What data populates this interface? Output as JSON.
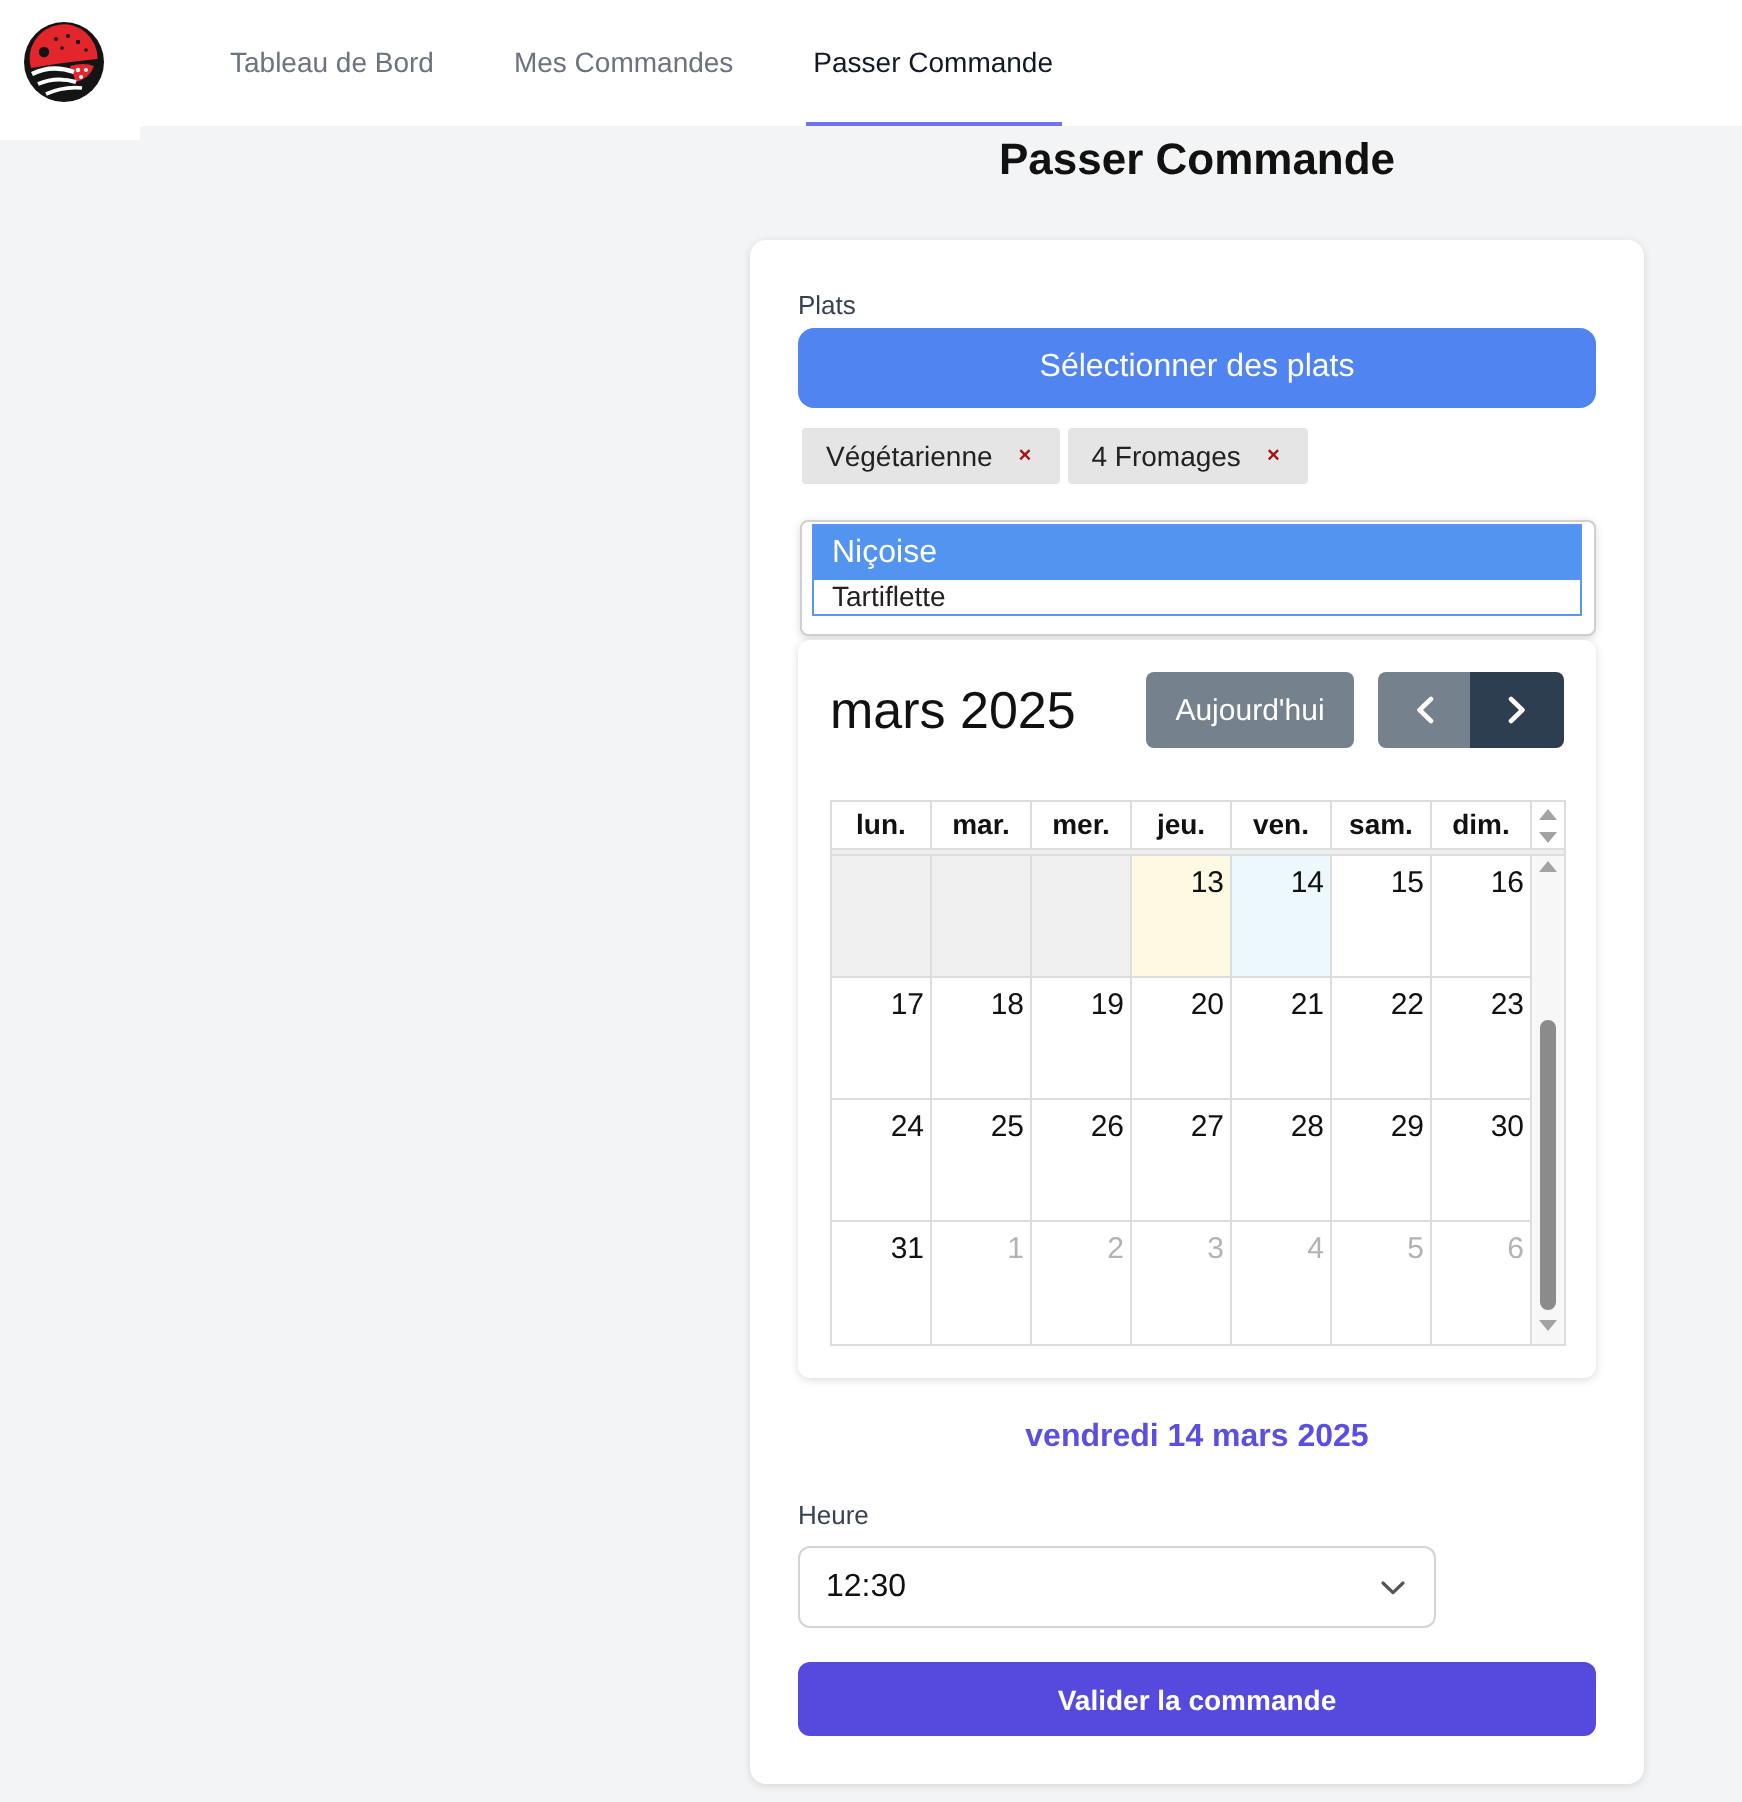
{
  "header": {
    "nav": [
      {
        "label": "Tableau de Bord",
        "selected": false
      },
      {
        "label": "Mes Commandes",
        "selected": false
      },
      {
        "label": "Passer Commande",
        "selected": true
      }
    ]
  },
  "page_title": "Passer Commande",
  "form": {
    "dishes": {
      "label": "Plats",
      "button": "Sélectionner des plats",
      "chips": [
        {
          "label": "Végétarienne",
          "remove": "×"
        },
        {
          "label": "4 Fromages",
          "remove": "×"
        }
      ],
      "options": [
        {
          "label": "Niçoise",
          "selected": true
        },
        {
          "label": "Tartiflette",
          "selected": false
        }
      ]
    },
    "calendar": {
      "title": "mars 2025",
      "today_button": {
        "label": "Aujourd'hui",
        "disabled": true
      },
      "prev_button": {
        "disabled": true
      },
      "next_button": {
        "disabled": false
      },
      "weekdays": [
        "lun.",
        "mar.",
        "mer.",
        "jeu.",
        "ven.",
        "sam.",
        "dim."
      ],
      "weeks": [
        [
          {
            "kind": "past",
            "today": false
          },
          {
            "kind": "past",
            "today": false
          },
          {
            "kind": "past",
            "today": false
          },
          {
            "day": "13",
            "kind": "current",
            "today": true,
            "selected": false
          },
          {
            "day": "14",
            "kind": "current",
            "today": false,
            "selected": true
          },
          {
            "day": "15",
            "kind": "current",
            "today": false,
            "selected": false
          },
          {
            "day": "16",
            "kind": "current",
            "today": false,
            "selected": false
          }
        ],
        [
          {
            "day": "17",
            "kind": "current",
            "today": false,
            "selected": false
          },
          {
            "day": "18",
            "kind": "current",
            "today": false,
            "selected": false
          },
          {
            "day": "19",
            "kind": "current",
            "today": false,
            "selected": false
          },
          {
            "day": "20",
            "kind": "current",
            "today": false,
            "selected": false
          },
          {
            "day": "21",
            "kind": "current",
            "today": false,
            "selected": false
          },
          {
            "day": "22",
            "kind": "current",
            "today": false,
            "selected": false
          },
          {
            "day": "23",
            "kind": "current",
            "today": false,
            "selected": false
          }
        ],
        [
          {
            "day": "24",
            "kind": "current",
            "today": false,
            "selected": false
          },
          {
            "day": "25",
            "kind": "current",
            "today": false,
            "selected": false
          },
          {
            "day": "26",
            "kind": "current",
            "today": false,
            "selected": false
          },
          {
            "day": "27",
            "kind": "current",
            "today": false,
            "selected": false
          },
          {
            "day": "28",
            "kind": "current",
            "today": false,
            "selected": false
          },
          {
            "day": "29",
            "kind": "current",
            "today": false,
            "selected": false
          },
          {
            "day": "30",
            "kind": "current",
            "today": false,
            "selected": false
          }
        ],
        [
          {
            "day": "31",
            "kind": "current",
            "today": false,
            "selected": false
          },
          {
            "day": "1",
            "kind": "other_month",
            "today": false,
            "selected": false
          },
          {
            "day": "2",
            "kind": "other_month",
            "today": false,
            "selected": false
          },
          {
            "day": "3",
            "kind": "other_month",
            "today": false,
            "selected": false
          },
          {
            "day": "4",
            "kind": "other_month",
            "today": false,
            "selected": false
          },
          {
            "day": "5",
            "kind": "other_month",
            "today": false,
            "selected": false
          },
          {
            "day": "6",
            "kind": "other_month",
            "today": false,
            "selected": false
          }
        ]
      ]
    },
    "selected_date": "vendredi 14 mars 2025",
    "time": {
      "label": "Heure",
      "value": "12:30"
    },
    "submit": "Valider la commande"
  }
}
